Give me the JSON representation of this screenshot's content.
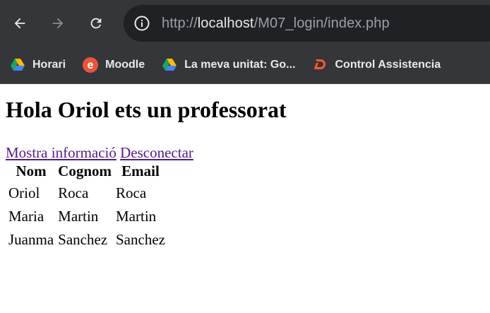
{
  "browser": {
    "url_prefix": "http://",
    "url_host": "localhost",
    "url_path": "/M07_login/index.php",
    "bookmarks": [
      {
        "label": "Horari",
        "icon": "google-drive-icon"
      },
      {
        "label": "Moodle",
        "icon": "moodle-icon"
      },
      {
        "label": "La meva unitat: Go...",
        "icon": "google-drive-icon"
      },
      {
        "label": "Control Assistencia",
        "icon": "d-logo-icon"
      }
    ],
    "colors": {
      "chrome": "#35363a",
      "omnibox": "#202124",
      "link_visited": "#551a8b"
    }
  },
  "page": {
    "heading": "Hola Oriol ets un professorat",
    "links": {
      "info": "Mostra informació",
      "logout": "Desconectar"
    },
    "table": {
      "headers": [
        "Nom",
        "Cognom",
        "Email"
      ],
      "rows": [
        [
          "Oriol",
          "Roca",
          "Roca"
        ],
        [
          "Maria",
          "Martin",
          "Martin"
        ],
        [
          "Juanma",
          "Sanchez",
          "Sanchez"
        ]
      ]
    }
  }
}
